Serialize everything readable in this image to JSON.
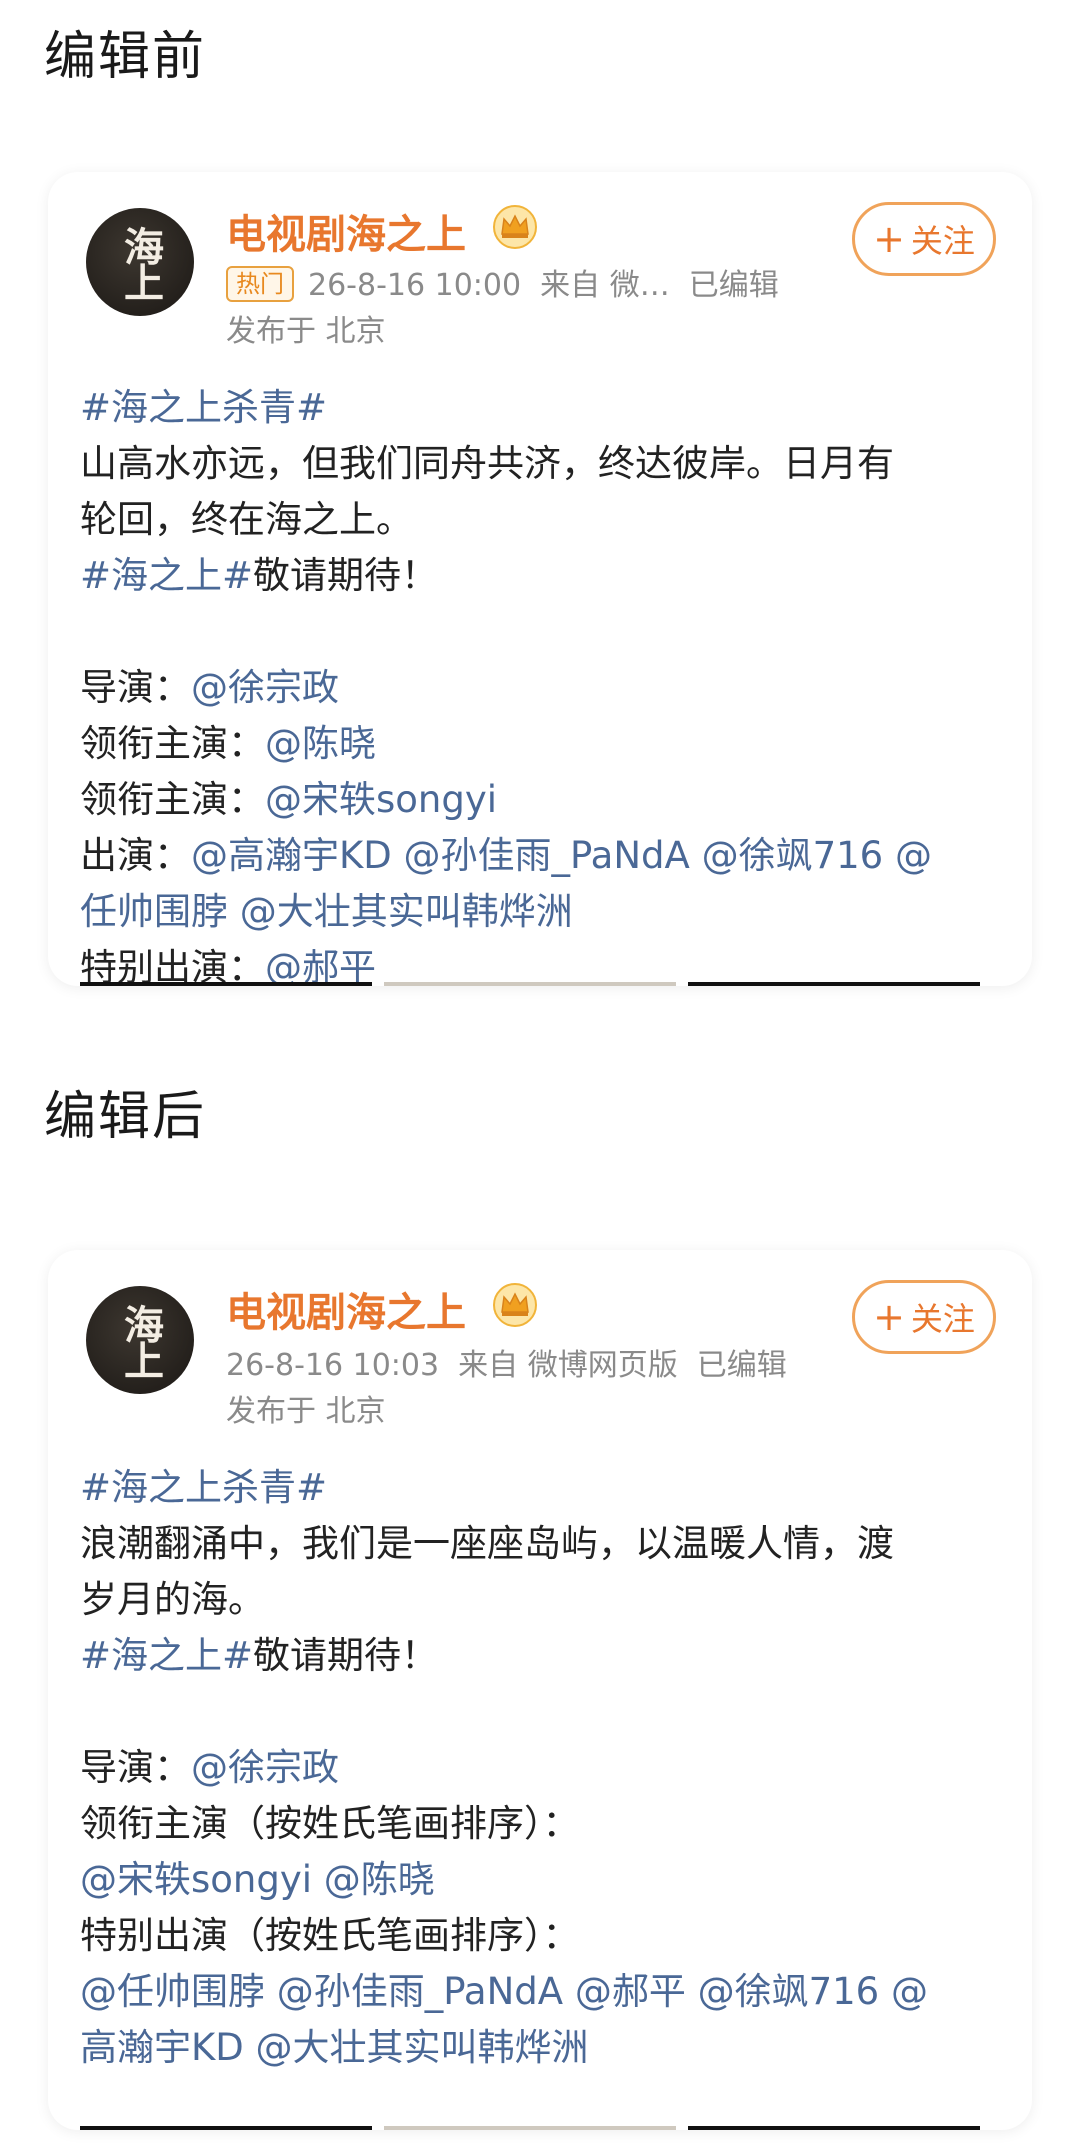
{
  "before": {
    "section_title": "编辑前",
    "account_name": "电视剧海之上",
    "avatar_text": "海上",
    "hot_badge": "热门",
    "timestamp": "26-8-16 10:00",
    "source": "来自 微…",
    "edited": "已编辑",
    "location": "发布于 北京",
    "follow_label": "关注",
    "hashtag1": "#海之上杀青#",
    "line1": "山高水亦远，但我们同舟共济，终达彼岸。日月有",
    "line2": "轮回，终在海之上。",
    "hashtag2": "#海之上#",
    "hashtag2_suffix": "敬请期待！",
    "director_label": "导演：",
    "director": "@徐宗政",
    "lead_label": "领衔主演：",
    "lead1": "@陈晓",
    "lead2": "@宋轶songyi",
    "cast_label": "出演：",
    "cast_line1": "@高瀚宇KD @孙佳雨_PaNdA @徐飒716 @",
    "cast_line2": "任帅围脖 @大壮其实叫韩烨洲",
    "special_label": "特别出演：",
    "special": "@郝平"
  },
  "after": {
    "section_title": "编辑后",
    "account_name": "电视剧海之上",
    "avatar_text": "海上",
    "timestamp": "26-8-16 10:03",
    "source": "来自 微博网页版",
    "edited": "已编辑",
    "location": "发布于 北京",
    "follow_label": "关注",
    "hashtag1": "#海之上杀青#",
    "line1": "浪潮翻涌中，我们是一座座岛屿，以温暖人情，渡",
    "line2": "岁月的海。",
    "hashtag2": "#海之上#",
    "hashtag2_suffix": "敬请期待！",
    "director_label": "导演：",
    "director": "@徐宗政",
    "lead_label": "领衔主演（按姓氏笔画排序）：",
    "leads": "@宋轶songyi @陈晓",
    "special_label": "特别出演（按姓氏笔画排序）：",
    "special_line1": "@任帅围脖 @孙佳雨_PaNdA @郝平 @徐飒716 @",
    "special_line2": "高瀚宇KD @大壮其实叫韩烨洲"
  },
  "colors": {
    "name_orange": "#e8772e",
    "link_blue": "#4a6896",
    "meta_gray": "#8a8a8a"
  }
}
